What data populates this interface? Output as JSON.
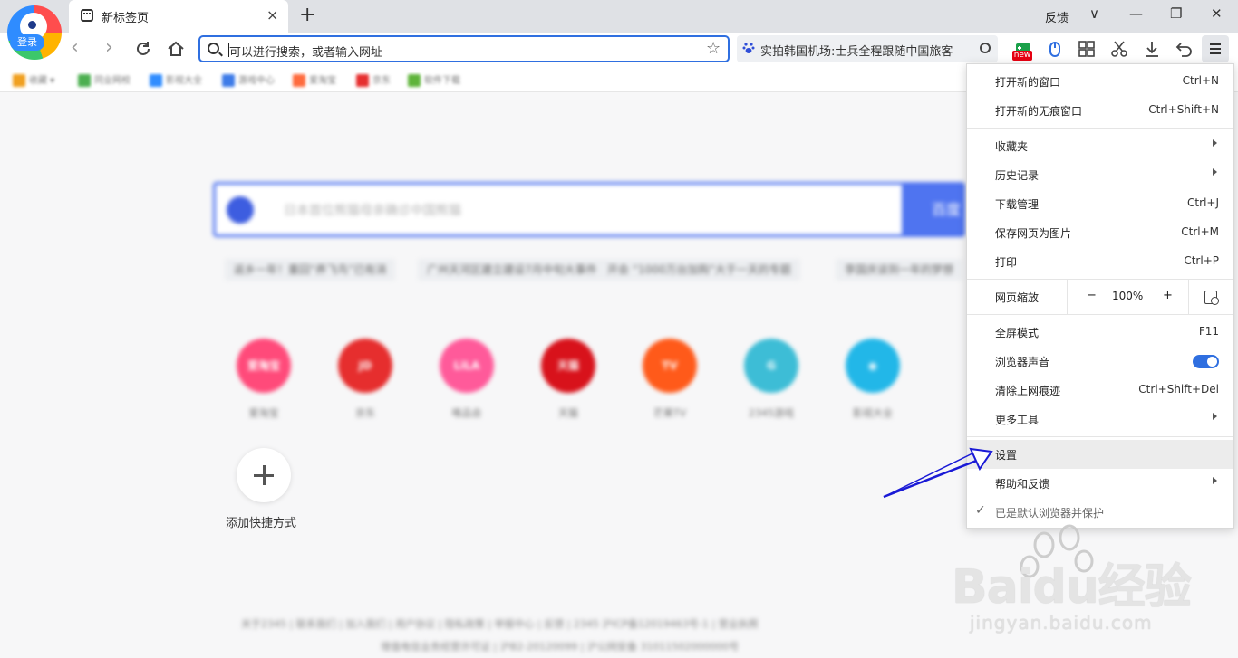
{
  "browser": {
    "login_label": "登录",
    "tab_title": "新标签页",
    "tab_close": "×",
    "new_tab": "+",
    "feedback": "反馈",
    "win_controls": [
      "∨",
      "—",
      "❐",
      "✕"
    ]
  },
  "toolbar": {
    "address_placeholder": "可以进行搜索，或者输入网址",
    "hot_search": "实拍韩国机场:士兵全程跟随中国旅客",
    "new_badge": "new",
    "icons": [
      "game-icon",
      "mouse-icon",
      "apps-icon",
      "scissors-icon",
      "download-icon",
      "undo-icon",
      "menu-icon"
    ]
  },
  "bookmarks": [
    "收藏",
    "同业网校",
    "影视大全",
    "游戏中心",
    "爱淘宝",
    "京东",
    "软件下载"
  ],
  "page": {
    "search_placeholder": "日本首位熊猫母亲确诊中国熊猫",
    "search_button": "百度",
    "hot_chips": [
      "返乡一年！重回“养飞鸟”已有消",
      "广州天河区建立建设7月中旬大事件",
      "开会 “1000万台加购”大于一天的专题",
      "李国庆谈到一年的梦想"
    ],
    "sites": [
      {
        "name": "爱淘宝",
        "badge": "爱淘宝",
        "color": "#ff4a7a"
      },
      {
        "name": "京东",
        "badge": "JD",
        "color": "#e62e2e"
      },
      {
        "name": "唯品会",
        "badge": "LiLA",
        "color": "#ff5a9a"
      },
      {
        "name": "天猫",
        "badge": "天猫",
        "color": "#d8121b"
      },
      {
        "name": "芒果TV",
        "badge": "TV",
        "color": "#ff5a1a"
      },
      {
        "name": "2345游戏",
        "badge": "G",
        "color": "#3dbdd6"
      },
      {
        "name": "影视大全",
        "badge": "◉",
        "color": "#22b7e8"
      }
    ],
    "add_shortcut": "添加快捷方式",
    "footer_line1": "关于2345 | 联系我们 | 加入我们 | 用户协议 | 隐私政策 | 举报中心 | 反馈 | 2345 沪ICP备12019463号-1 | 营业执照",
    "footer_line2": "增值电信业务经营许可证 | 沪B2-20120099 | 沪公网安备 31011502000000号"
  },
  "menu": {
    "new_window": {
      "label": "打开新的窗口",
      "shortcut": "Ctrl+N"
    },
    "new_incognito": {
      "label": "打开新的无痕窗口",
      "shortcut": "Ctrl+Shift+N"
    },
    "favorites": {
      "label": "收藏夹"
    },
    "history": {
      "label": "历史记录"
    },
    "downloads": {
      "label": "下载管理",
      "shortcut": "Ctrl+J"
    },
    "save_image": {
      "label": "保存网页为图片",
      "shortcut": "Ctrl+M"
    },
    "print": {
      "label": "打印",
      "shortcut": "Ctrl+P"
    },
    "zoom": {
      "label": "网页缩放",
      "minus": "−",
      "value": "100%",
      "plus": "+"
    },
    "fullscreen": {
      "label": "全屏模式",
      "shortcut": "F11"
    },
    "sound": {
      "label": "浏览器声音",
      "enabled": true
    },
    "clear_traces": {
      "label": "清除上网痕迹",
      "shortcut": "Ctrl+Shift+Del"
    },
    "more_tools": {
      "label": "更多工具"
    },
    "settings": {
      "label": "设置"
    },
    "help": {
      "label": "帮助和反馈"
    },
    "default_browser": {
      "label": "已是默认浏览器并保护",
      "check": "✓"
    }
  },
  "watermark": {
    "logo_text": "Baidu经验",
    "url": "jingyan.baidu.com"
  },
  "colors": {
    "accent": "#2f6fe0",
    "annotation_arrow": "#1a1ad6",
    "menu_highlight": "#ececec"
  }
}
